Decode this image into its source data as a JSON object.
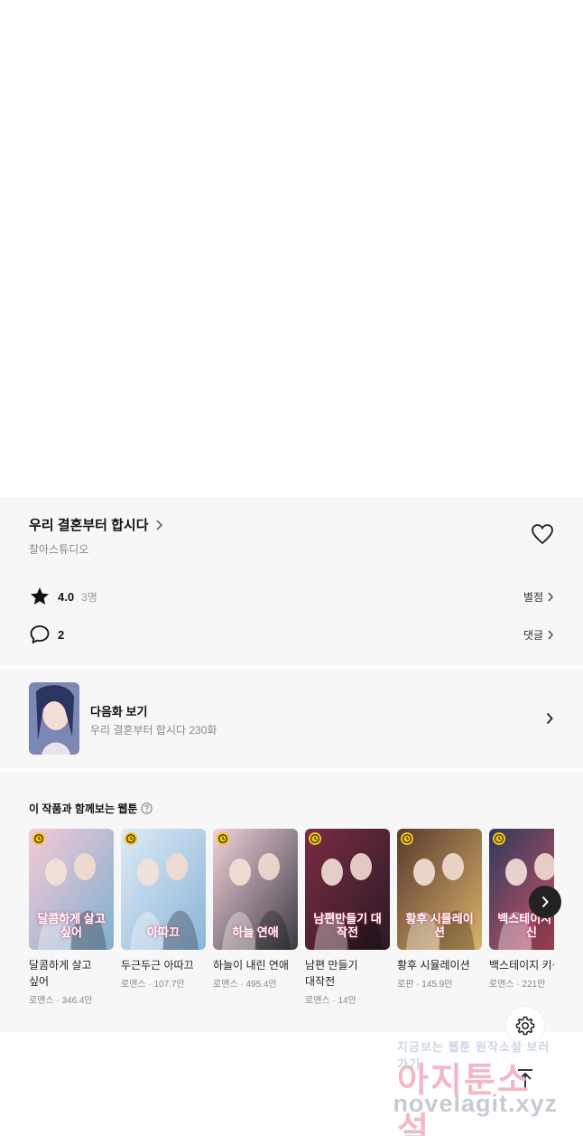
{
  "work": {
    "title": "우리 결혼부터 합시다",
    "author": "찰아스튜디오",
    "rating": "4.0",
    "rating_count": "3명",
    "rating_link": "별점",
    "comment_count": "2",
    "comment_link": "댓글"
  },
  "next_episode": {
    "label": "다음화 보기",
    "subtitle": "우리 결혼부터 합시다 230화"
  },
  "recommendations": {
    "heading": "이 작품과 함께보는 웹툰",
    "items": [
      {
        "title": "달콤하게 살고 싶어",
        "meta": "로맨스 · 346.4만",
        "cover_text": "달콤하게 살고싶어",
        "cover_colors": [
          "#f6c9d6",
          "#7fb0cf"
        ]
      },
      {
        "title": "두근두근 아따끄",
        "meta": "로맨스 · 107.7만",
        "cover_text": "아따끄",
        "cover_colors": [
          "#dcebf6",
          "#8cb4d8"
        ]
      },
      {
        "title": "하늘이 내린 연애",
        "meta": "로맨스 · 495.4만",
        "cover_text": "하늘 연애",
        "cover_colors": [
          "#f3d1dc",
          "#3b3b44"
        ]
      },
      {
        "title": "남편 만들기 대작전",
        "meta": "로맨스 · 14만",
        "cover_text": "남편만들기 대작전",
        "cover_colors": [
          "#7a2c45",
          "#2b1a24"
        ]
      },
      {
        "title": "황후 시뮬레이션",
        "meta": "로판 · 145.9만",
        "cover_text": "황후 시뮬레이션",
        "cover_colors": [
          "#5a3a2e",
          "#d9b26a"
        ]
      },
      {
        "title": "백스테이지 키신",
        "meta": "로맨스 · 221만",
        "cover_text": "백스테이지 키신",
        "cover_colors": [
          "#2c3a5a",
          "#e2576a"
        ]
      }
    ]
  },
  "watermark": {
    "line1": "지금보는 웹툰 원작소설 보러가기",
    "line2": "아지툰소설",
    "line3": "novelagit.xyz"
  },
  "colors": {
    "panel_bg": "#f7f7f8",
    "accent_dark": "#222222",
    "clock_badge": "#f5c518"
  }
}
